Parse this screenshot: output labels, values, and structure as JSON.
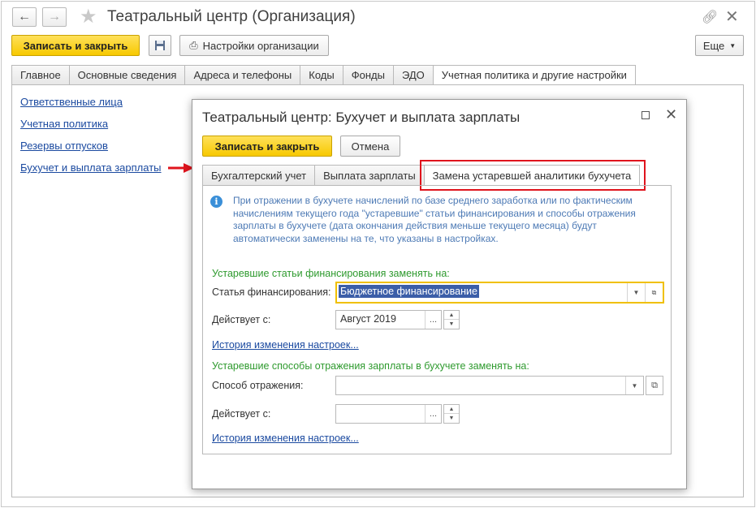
{
  "window": {
    "title": "Театральный центр (Организация)"
  },
  "toolbar": {
    "save_close": "Записать и закрыть",
    "settings": "Настройки организации",
    "more": "Еще"
  },
  "main_tabs": [
    {
      "label": "Главное"
    },
    {
      "label": "Основные сведения"
    },
    {
      "label": "Адреса и телефоны"
    },
    {
      "label": "Коды"
    },
    {
      "label": "Фонды"
    },
    {
      "label": "ЭДО"
    },
    {
      "label": "Учетная политика и другие настройки"
    }
  ],
  "sidebar": {
    "links": [
      {
        "label": "Ответственные лица"
      },
      {
        "label": "Учетная политика"
      },
      {
        "label": "Резервы отпусков"
      },
      {
        "label": "Бухучет и выплата зарплаты"
      }
    ]
  },
  "dialog": {
    "title": "Театральный центр: Бухучет и выплата зарплаты",
    "save_close": "Записать и закрыть",
    "cancel": "Отмена",
    "tabs": [
      {
        "label": "Бухгалтерский учет"
      },
      {
        "label": "Выплата зарплаты"
      },
      {
        "label": "Замена устаревшей аналитики бухучета"
      }
    ],
    "info_text": "При отражении в бухучете начислений по базе среднего заработка или по фактическим начислениям текущего года \"устаревшие\" статьи финансирования и способы отражения зарплаты в бухучете (дата окончания действия меньше текущего месяца) будут автоматически заменены на те, что указаны в настройках.",
    "section1": {
      "heading": "Устаревшие статьи финансирования заменять на:",
      "field_label": "Статья финансирования:",
      "field_value": "Бюджетное финансирование",
      "date_label": "Действует с:",
      "date_value": "Август 2019",
      "history_link": "История изменения настроек..."
    },
    "section2": {
      "heading": "Устаревшие способы отражения зарплаты в бухучете заменять на:",
      "field_label": "Способ отражения:",
      "field_value": "",
      "date_label": "Действует с:",
      "date_value": "",
      "history_link": "История изменения настроек..."
    }
  },
  "colors": {
    "accent_yellow": "#f7c900",
    "link_blue": "#1b4aa0",
    "green_heading": "#2e9a2e",
    "highlight_red": "#e0141d"
  }
}
